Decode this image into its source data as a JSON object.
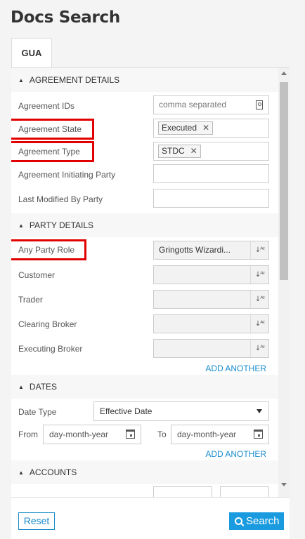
{
  "page": {
    "title": "Docs Search"
  },
  "tabs": [
    {
      "label": "GUA"
    }
  ],
  "agreement_details": {
    "heading": "AGREEMENT DETAILS",
    "agreement_ids": {
      "label": "Agreement IDs",
      "placeholder": "comma separated"
    },
    "agreement_state": {
      "label": "Agreement State",
      "chip": "Executed"
    },
    "agreement_type": {
      "label": "Agreement Type",
      "chip": "STDC"
    },
    "initiating_party": {
      "label": "Agreement Initiating Party",
      "value": ""
    },
    "last_modified": {
      "label": "Last Modified By Party",
      "value": ""
    }
  },
  "party_details": {
    "heading": "PARTY DETAILS",
    "rows": [
      {
        "label": "Any Party Role",
        "value": "Gringotts Wizardi..."
      },
      {
        "label": "Customer",
        "value": ""
      },
      {
        "label": "Trader",
        "value": ""
      },
      {
        "label": "Clearing Broker",
        "value": ""
      },
      {
        "label": "Executing Broker",
        "value": ""
      }
    ],
    "add_another": "ADD ANOTHER"
  },
  "dates": {
    "heading": "DATES",
    "date_type_label": "Date Type",
    "date_type_value": "Effective Date",
    "from_label": "From",
    "from_placeholder": "day-month-year",
    "to_label": "To",
    "to_placeholder": "day-month-year",
    "add_another": "ADD ANOTHER"
  },
  "accounts": {
    "heading": "ACCOUNTS"
  },
  "footer": {
    "reset_label": "Reset",
    "search_label": "Search"
  },
  "colors": {
    "accent": "#1a9be0",
    "highlight": "#e00000"
  },
  "icons": {
    "section_toggle": "triangle-up-icon",
    "clear": "close-icon",
    "sort": "sort-az-icon",
    "calendar": "calendar-icon",
    "search": "search-icon",
    "contact": "contact-card-icon"
  }
}
